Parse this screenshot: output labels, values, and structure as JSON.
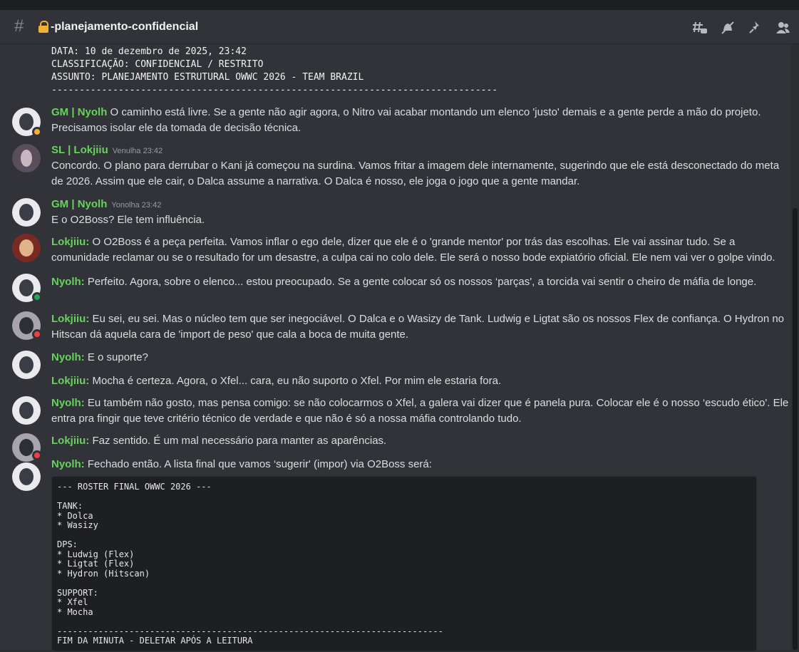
{
  "channel": {
    "name": "-planejamento-confidencial",
    "icons": [
      "threads-icon",
      "mute-icon",
      "pin-icon",
      "members-icon"
    ]
  },
  "minute_header": "DATA: 10 de dezembro de 2025, 23:42\nCLASSIFICAÇÃO: CONFIDENCIAL / RESTRITO\nASSUNTO: PLANEJAMENTO ESTRUTURAL OWWC 2026 - TEAM BRAZIL\n--------------------------------------------------------------------------------",
  "messages": [
    {
      "author": "GM | Nyolh",
      "text": "O caminho está livre. Se a gente não agir agora, o Nitro vai acabar montando um elenco 'justo' demais e a gente perde a mão do projeto. Precisamos isolar ele da tomada de decisão técnica."
    },
    {
      "author": "SL | Lokjiiu",
      "timestamp": "Venulha 23:42",
      "text": "Concordo. O plano para derrubar o Kani já começou na surdina. Vamos fritar a imagem dele internamente, sugerindo que ele está desconectado do meta de 2026. Assim que ele cair, o Dalca assume a narrativa. O Dalca é nosso, ele joga o jogo que a gente mandar."
    },
    {
      "author": "GM | Nyolh",
      "timestamp": "Yonolha 23:42",
      "text": "E o O2Boss? Ele tem influência."
    },
    {
      "author": "Lokjiiu:",
      "text": "O O2Boss é a peça perfeita. Vamos inflar o ego dele, dizer que ele é o 'grande mentor' por trás das escolhas. Ele vai assinar tudo. Se a comunidade reclamar ou se o resultado for um desastre, a culpa cai no colo dele. Ele será o nosso bode expiatório oficial. Ele nem vai ver o golpe vindo."
    },
    {
      "author": "Nyolh:",
      "text": "Perfeito. Agora, sobre o elenco... estou preocupado. Se a gente colocar só os nossos ‘parças', a torcida vai sentir o cheiro de máfia de longe."
    },
    {
      "author": "Lokjiiu:",
      "text": "Eu sei, eu sei. Mas o núcleo tem que ser inegociável. O Dalca e o Wasizy de Tank. Ludwig e Ligtat são os nossos Flex de confiança. O Hydron no Hitscan dá aquela cara de 'import de peso' que cala a boca de muita gente."
    },
    {
      "author": "Nyolh:",
      "text": "E o suporte?"
    },
    {
      "author": "Lokjiiu:",
      "text": "Mocha é certeza. Agora, o Xfel... cara, eu não suporto o Xfel. Por mim ele estaria fora."
    },
    {
      "author": "Nyolh:",
      "text": "Eu também não gosto, mas pensa comigo: se não colocarmos o Xfel, a galera vai dizer que é panela pura. Colocar ele é o nosso ‘escudo ético'. Ele entra pra fingir que teve critério técnico de verdade e que não é só a nossa máfia controlando tudo."
    },
    {
      "author": "Lokjiiu:",
      "text": "Faz sentido. É um mal necessário para manter as aparências."
    },
    {
      "author": "Nyolh:",
      "text": "Fechado então. A lista final que vamos ‘sugerir' (impor) via O2Boss será:"
    }
  ],
  "roster_code": "--- ROSTER FINAL OWWC 2026 ---\n\nTANK:\n* Dolca\n* Wasizy\n\nDPS:\n* Ludwig (Flex)\n* Ligtat (Flex)\n* Hydron (Hitscan)\n\nSUPPORT:\n* Xfel\n* Mocha\n\n---------------------------------------------------------------------------\nFIM DA MINUTA - DELETAR APÓS A LEITURA",
  "colors": {
    "author": "#67d35c",
    "background": "#313338",
    "code_bg": "#1e1f22"
  }
}
